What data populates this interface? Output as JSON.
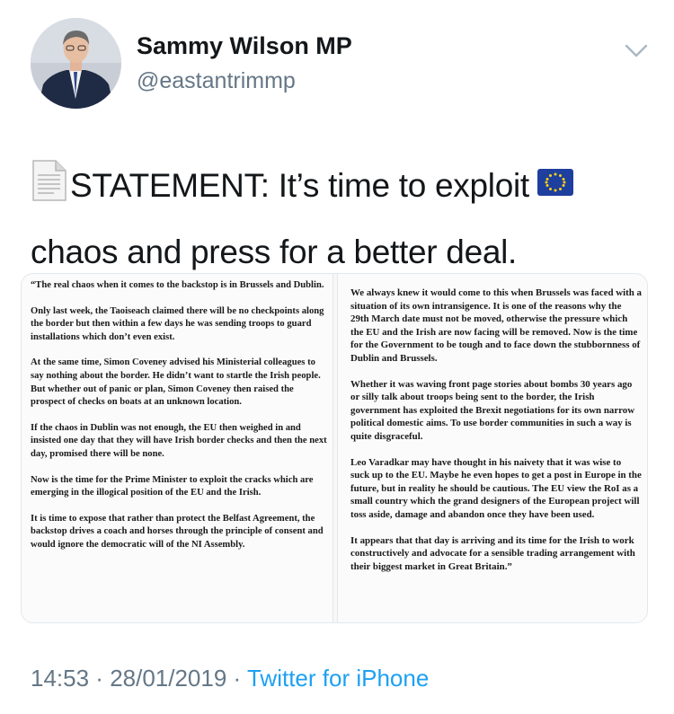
{
  "author": {
    "name": "Sammy Wilson MP",
    "handle": "@eastantrimmp"
  },
  "icons": {
    "avatar": "profile-photo",
    "menu": "chevron-down-icon",
    "document_emoji": "page-facing-up-emoji",
    "flag_emoji": "eu-flag-emoji"
  },
  "tweet": {
    "text_main": "STATEMENT: It’s time to exploit",
    "text_rest": "chaos and press for a better deal."
  },
  "statement": {
    "left": [
      "“The real chaos when it comes to the backstop is in Brussels and Dublin.",
      "Only last week, the Taoiseach claimed there will be no checkpoints along the border but then within a few days he was sending troops to guard installations which don’t even exist.",
      "At the same time, Simon Coveney advised his Ministerial colleagues to say nothing about the border.  He didn’t want to startle the Irish people. But whether out of panic or plan, Simon Coveney then raised the prospect of checks on boats at an unknown location.",
      "If the chaos in Dublin was not enough, the EU then weighed in and insisted one day that they will have Irish border checks and then the next day, promised there will be none.",
      "Now is the time for the Prime Minister to exploit the cracks which are emerging in the illogical position of the EU and the Irish.",
      "It is time to expose that rather than protect the Belfast Agreement, the backstop drives a coach and horses through the principle of consent and would ignore the democratic will of the NI Assembly."
    ],
    "right": [
      "We always knew it would come to this when Brussels was faced with a situation of its own intransigence. It is one of the reasons why the 29th March date must not be moved, otherwise the pressure which the EU and the Irish are now facing will be removed. Now is the time for the Government to be tough and to face down the stubbornness of Dublin and Brussels.",
      "Whether it was waving front page stories about bombs 30 years ago or silly talk about troops being sent to the border, the Irish government has exploited the Brexit negotiations for its own narrow political domestic aims. To use border communities in such a way is quite disgraceful.",
      "Leo Varadkar may have thought in his naivety that it was wise to suck up to the EU. Maybe he even hopes to get a post in Europe in the future, but in reality he should be cautious. The EU view the RoI as a small country which the grand designers of the European project will toss aside, damage and abandon once they have been used.",
      "It appears that that day is arriving and its time for the Irish to work constructively and advocate for a sensible trading arrangement with their biggest market in Great Britain.”"
    ]
  },
  "meta": {
    "time": "14:53",
    "sep1": " · ",
    "date": "28/01/2019",
    "sep2": " · ",
    "source": "Twitter for iPhone"
  }
}
